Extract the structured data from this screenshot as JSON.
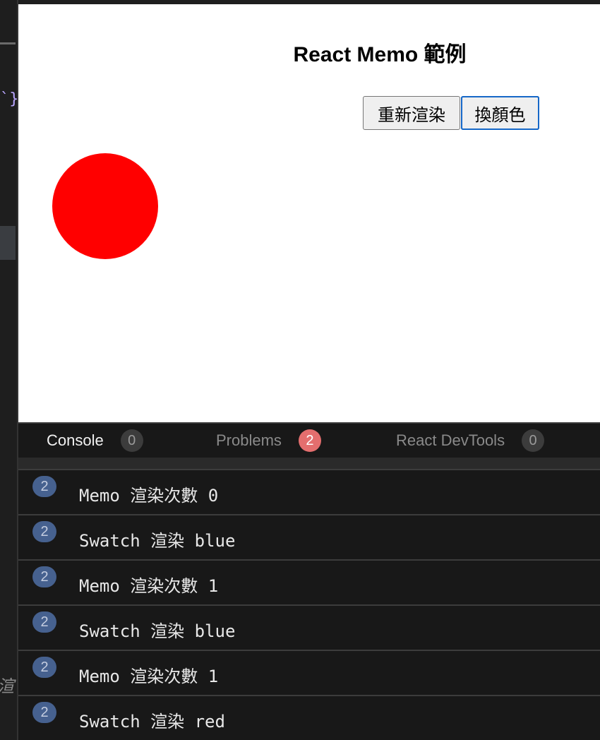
{
  "preview": {
    "title": "React Memo 範例",
    "rerender_button": "重新渲染",
    "swap_color_button": "換顏色",
    "swatch_color": "#ff0000"
  },
  "devtools": {
    "tabs": [
      {
        "label": "Console",
        "count": "0",
        "active": true
      },
      {
        "label": "Problems",
        "count": "2",
        "active": false
      },
      {
        "label": "React DevTools",
        "count": "0",
        "active": false
      }
    ],
    "logs": [
      {
        "count": "2",
        "text": "Memo 渲染次數 0"
      },
      {
        "count": "2",
        "text": "Swatch 渲染 blue"
      },
      {
        "count": "2",
        "text": "Memo 渲染次數 1"
      },
      {
        "count": "2",
        "text": "Swatch 渲染 blue"
      },
      {
        "count": "2",
        "text": "Memo 渲染次數 1"
      },
      {
        "count": "2",
        "text": "Swatch 渲染 red"
      }
    ]
  },
  "colors": {
    "badge_problems": "#e46e6e",
    "log_count_badge": "#46618f",
    "focus_outline": "#1668c8"
  }
}
